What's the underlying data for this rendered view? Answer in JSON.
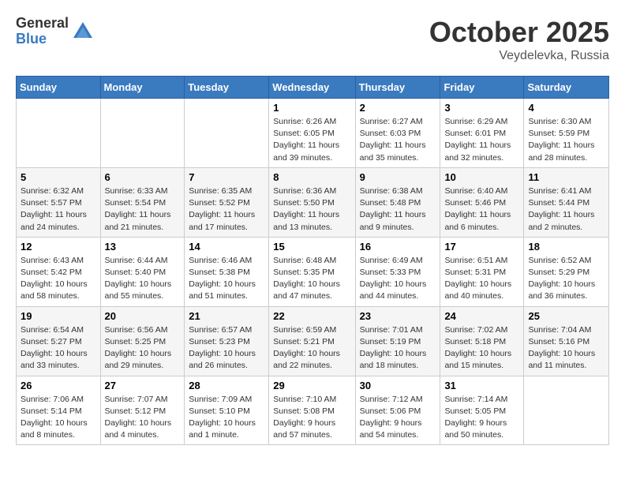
{
  "header": {
    "logo_general": "General",
    "logo_blue": "Blue",
    "month_title": "October 2025",
    "location": "Veydelevka, Russia"
  },
  "weekdays": [
    "Sunday",
    "Monday",
    "Tuesday",
    "Wednesday",
    "Thursday",
    "Friday",
    "Saturday"
  ],
  "weeks": [
    [
      {
        "day": "",
        "info": ""
      },
      {
        "day": "",
        "info": ""
      },
      {
        "day": "",
        "info": ""
      },
      {
        "day": "1",
        "info": "Sunrise: 6:26 AM\nSunset: 6:05 PM\nDaylight: 11 hours\nand 39 minutes."
      },
      {
        "day": "2",
        "info": "Sunrise: 6:27 AM\nSunset: 6:03 PM\nDaylight: 11 hours\nand 35 minutes."
      },
      {
        "day": "3",
        "info": "Sunrise: 6:29 AM\nSunset: 6:01 PM\nDaylight: 11 hours\nand 32 minutes."
      },
      {
        "day": "4",
        "info": "Sunrise: 6:30 AM\nSunset: 5:59 PM\nDaylight: 11 hours\nand 28 minutes."
      }
    ],
    [
      {
        "day": "5",
        "info": "Sunrise: 6:32 AM\nSunset: 5:57 PM\nDaylight: 11 hours\nand 24 minutes."
      },
      {
        "day": "6",
        "info": "Sunrise: 6:33 AM\nSunset: 5:54 PM\nDaylight: 11 hours\nand 21 minutes."
      },
      {
        "day": "7",
        "info": "Sunrise: 6:35 AM\nSunset: 5:52 PM\nDaylight: 11 hours\nand 17 minutes."
      },
      {
        "day": "8",
        "info": "Sunrise: 6:36 AM\nSunset: 5:50 PM\nDaylight: 11 hours\nand 13 minutes."
      },
      {
        "day": "9",
        "info": "Sunrise: 6:38 AM\nSunset: 5:48 PM\nDaylight: 11 hours\nand 9 minutes."
      },
      {
        "day": "10",
        "info": "Sunrise: 6:40 AM\nSunset: 5:46 PM\nDaylight: 11 hours\nand 6 minutes."
      },
      {
        "day": "11",
        "info": "Sunrise: 6:41 AM\nSunset: 5:44 PM\nDaylight: 11 hours\nand 2 minutes."
      }
    ],
    [
      {
        "day": "12",
        "info": "Sunrise: 6:43 AM\nSunset: 5:42 PM\nDaylight: 10 hours\nand 58 minutes."
      },
      {
        "day": "13",
        "info": "Sunrise: 6:44 AM\nSunset: 5:40 PM\nDaylight: 10 hours\nand 55 minutes."
      },
      {
        "day": "14",
        "info": "Sunrise: 6:46 AM\nSunset: 5:38 PM\nDaylight: 10 hours\nand 51 minutes."
      },
      {
        "day": "15",
        "info": "Sunrise: 6:48 AM\nSunset: 5:35 PM\nDaylight: 10 hours\nand 47 minutes."
      },
      {
        "day": "16",
        "info": "Sunrise: 6:49 AM\nSunset: 5:33 PM\nDaylight: 10 hours\nand 44 minutes."
      },
      {
        "day": "17",
        "info": "Sunrise: 6:51 AM\nSunset: 5:31 PM\nDaylight: 10 hours\nand 40 minutes."
      },
      {
        "day": "18",
        "info": "Sunrise: 6:52 AM\nSunset: 5:29 PM\nDaylight: 10 hours\nand 36 minutes."
      }
    ],
    [
      {
        "day": "19",
        "info": "Sunrise: 6:54 AM\nSunset: 5:27 PM\nDaylight: 10 hours\nand 33 minutes."
      },
      {
        "day": "20",
        "info": "Sunrise: 6:56 AM\nSunset: 5:25 PM\nDaylight: 10 hours\nand 29 minutes."
      },
      {
        "day": "21",
        "info": "Sunrise: 6:57 AM\nSunset: 5:23 PM\nDaylight: 10 hours\nand 26 minutes."
      },
      {
        "day": "22",
        "info": "Sunrise: 6:59 AM\nSunset: 5:21 PM\nDaylight: 10 hours\nand 22 minutes."
      },
      {
        "day": "23",
        "info": "Sunrise: 7:01 AM\nSunset: 5:19 PM\nDaylight: 10 hours\nand 18 minutes."
      },
      {
        "day": "24",
        "info": "Sunrise: 7:02 AM\nSunset: 5:18 PM\nDaylight: 10 hours\nand 15 minutes."
      },
      {
        "day": "25",
        "info": "Sunrise: 7:04 AM\nSunset: 5:16 PM\nDaylight: 10 hours\nand 11 minutes."
      }
    ],
    [
      {
        "day": "26",
        "info": "Sunrise: 7:06 AM\nSunset: 5:14 PM\nDaylight: 10 hours\nand 8 minutes."
      },
      {
        "day": "27",
        "info": "Sunrise: 7:07 AM\nSunset: 5:12 PM\nDaylight: 10 hours\nand 4 minutes."
      },
      {
        "day": "28",
        "info": "Sunrise: 7:09 AM\nSunset: 5:10 PM\nDaylight: 10 hours\nand 1 minute."
      },
      {
        "day": "29",
        "info": "Sunrise: 7:10 AM\nSunset: 5:08 PM\nDaylight: 9 hours\nand 57 minutes."
      },
      {
        "day": "30",
        "info": "Sunrise: 7:12 AM\nSunset: 5:06 PM\nDaylight: 9 hours\nand 54 minutes."
      },
      {
        "day": "31",
        "info": "Sunrise: 7:14 AM\nSunset: 5:05 PM\nDaylight: 9 hours\nand 50 minutes."
      },
      {
        "day": "",
        "info": ""
      }
    ]
  ]
}
